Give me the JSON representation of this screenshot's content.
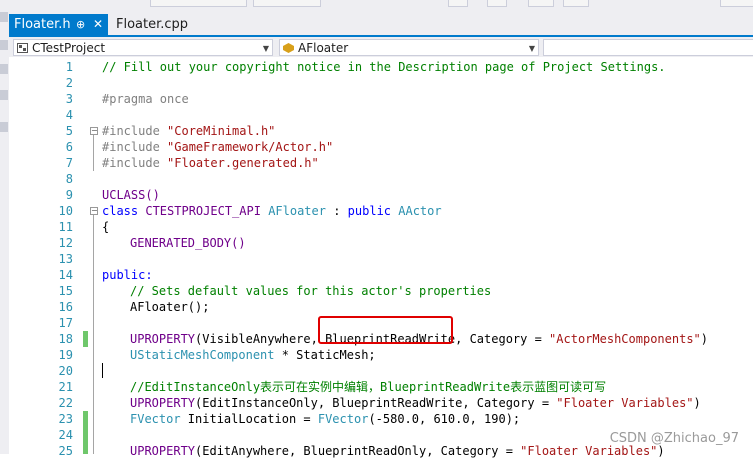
{
  "tabs": [
    {
      "label": "Floater.h",
      "pin": "⊕",
      "close": "✕",
      "active": true
    },
    {
      "label": "Floater.cpp",
      "active": false
    }
  ],
  "nav": {
    "project": "CTestProject",
    "class": "AFloater",
    "member": ""
  },
  "line_numbers": [
    "1",
    "2",
    "3",
    "4",
    "5",
    "6",
    "7",
    "8",
    "9",
    "10",
    "11",
    "12",
    "13",
    "14",
    "15",
    "16",
    "17",
    "18",
    "19",
    "20",
    "21",
    "22",
    "23",
    "24",
    "25"
  ],
  "code": {
    "l1": "// Fill out your copyright notice in the Description page of Project Settings.",
    "l3": "#pragma once",
    "l5_inc": "#include ",
    "l5_str": "\"CoreMinimal.h\"",
    "l6_inc": "#include ",
    "l6_str": "\"GameFramework/Actor.h\"",
    "l7_inc": "#include ",
    "l7_str": "\"Floater.generated.h\"",
    "l9": "UCLASS()",
    "l10_kw": "class ",
    "l10_api": "CTESTPROJECT_API ",
    "l10_name": "AFloater",
    "l10_rest": " : ",
    "l10_pub": "public ",
    "l10_base": "AActor",
    "l11": "{",
    "l12": "GENERATED_BODY()",
    "l14": "public:",
    "l15": "// Sets default values for this actor's properties",
    "l16": "AFloater();",
    "l18_mac": "UPROPERTY",
    "l18_a": "(VisibleAnywhere, BlueprintReadWrite, Category = ",
    "l18_str": "\"ActorMeshComponents\"",
    "l18_end": ")",
    "l19_ty": "UStaticMeshComponent",
    "l19_rest": " * StaticMesh;",
    "l21": "//EditInstanceOnly表示可在实例中编辑，BlueprintReadWrite表示蓝图可读可写",
    "l22_mac": "UPROPERTY",
    "l22_a": "(EditInstanceOnly, BlueprintReadWrite, Category = ",
    "l22_str": "\"Floater Variables\"",
    "l22_end": ")",
    "l23_ty": "FVector",
    "l23_a": " InitialLocation = ",
    "l23_ty2": "FVector",
    "l23_b": "(-580.0, 610.0, 190);",
    "l25_mac": "UPROPERTY",
    "l25_a": "(EditAnywhere, BlueprintReadOnly, Category = ",
    "l25_str": "\"Floater Variables\"",
    "l25_end": ")"
  },
  "colors": {
    "accent": "#007acc",
    "comment": "#008000",
    "keyword": "#0000ff",
    "string": "#a31515",
    "type": "#2b91af",
    "macro": "#6f008a",
    "highlight_box": "#e00000",
    "change_bar": "#6fc76b"
  },
  "watermark": "CSDN @Zhichao_97"
}
